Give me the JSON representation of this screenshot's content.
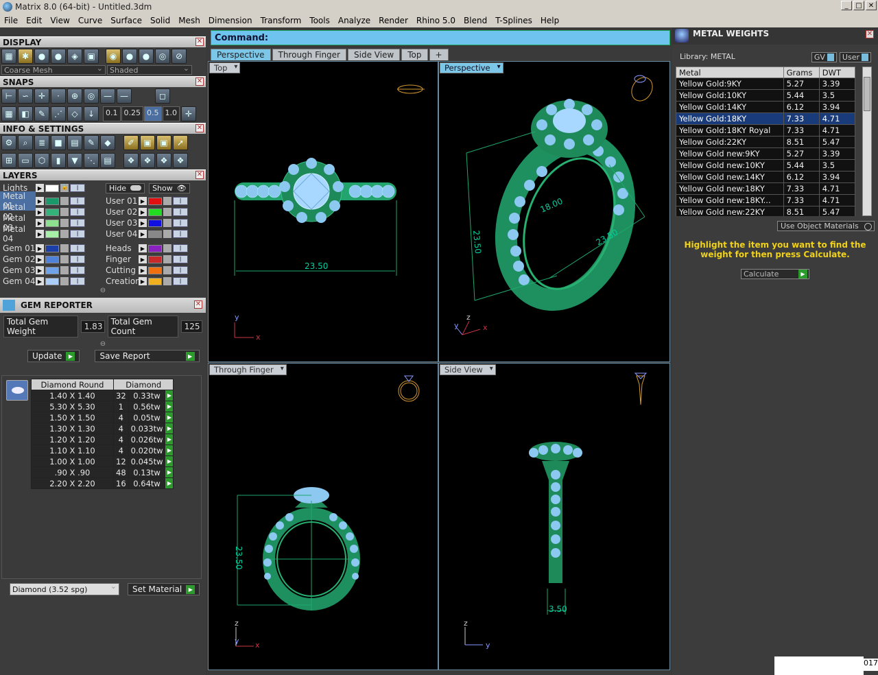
{
  "window": {
    "title": "Matrix 8.0 (64-bit) - Untitled.3dm"
  },
  "menu": [
    "File",
    "Edit",
    "View",
    "Curve",
    "Surface",
    "Solid",
    "Mesh",
    "Dimension",
    "Transform",
    "Tools",
    "Analyze",
    "Render",
    "Rhino 5.0",
    "Blend",
    "T-Splines",
    "Help"
  ],
  "display": {
    "title": "DISPLAY",
    "mesh_select": "Coarse Mesh",
    "shade_select": "Shaded"
  },
  "snaps": {
    "title": "SNAPS",
    "values": [
      "0.1",
      "0.25",
      "0.5",
      "1.0"
    ]
  },
  "info": {
    "title": "INFO & SETTINGS"
  },
  "layers": {
    "title": "LAYERS",
    "lights": "Lights",
    "hide": "Hide",
    "show": "Show",
    "left": [
      {
        "name": "Metal 01",
        "color": "#1a9a6a"
      },
      {
        "name": "Metal 02",
        "color": "#34b27a"
      },
      {
        "name": "Metal 03",
        "color": "#8de08e"
      },
      {
        "name": "Metal 04",
        "color": "#a8f0a8"
      },
      {
        "name": "Gem 01",
        "color": "#1d3fa8"
      },
      {
        "name": "Gem 02",
        "color": "#4f82d8"
      },
      {
        "name": "Gem 03",
        "color": "#6fa2e8"
      },
      {
        "name": "Gem 04",
        "color": "#a9cdf8"
      }
    ],
    "right": [
      {
        "name": "User 01",
        "color": "#e01010"
      },
      {
        "name": "User 02",
        "color": "#22dd22"
      },
      {
        "name": "User 03",
        "color": "#1010e0"
      },
      {
        "name": "User 04",
        "color": "#888888"
      },
      {
        "name": "Heads",
        "color": "#8a22c0"
      },
      {
        "name": "Finger",
        "color": "#c82a2a"
      },
      {
        "name": "Cutting",
        "color": "#f07010"
      },
      {
        "name": "Creation",
        "color": "#f0b020"
      }
    ]
  },
  "gem_reporter": {
    "title": "GEM REPORTER",
    "weight_label": "Total Gem Weight",
    "weight": "1.83",
    "count_label": "Total Gem Count",
    "count": "125",
    "update": "Update",
    "save": "Save Report",
    "col1": "Diamond Round",
    "col2": "Diamond",
    "rows": [
      [
        "1.40 X 1.40",
        "32",
        "0.33tw"
      ],
      [
        "5.30 X 5.30",
        "1",
        "0.56tw"
      ],
      [
        "1.50 X 1.50",
        "4",
        "0.05tw"
      ],
      [
        "1.30 X 1.30",
        "4",
        "0.033tw"
      ],
      [
        "1.20 X 1.20",
        "4",
        "0.026tw"
      ],
      [
        "1.10 X 1.10",
        "4",
        "0.020tw"
      ],
      [
        "1.00 X 1.00",
        "12",
        "0.045tw"
      ],
      [
        ".90 X .90",
        "48",
        "0.13tw"
      ],
      [
        "2.20 X 2.20",
        "16",
        "0.64tw"
      ]
    ],
    "material": "Diamond    (3.52 spg)",
    "set_material": "Set Material"
  },
  "command": {
    "label": "Command:"
  },
  "viewtabs": [
    "Perspective",
    "Through Finger",
    "Side View",
    "Top",
    "+"
  ],
  "viewports": {
    "top": "Top",
    "persp": "Perspective",
    "finger": "Through Finger",
    "side": "Side View",
    "dim_top": "23.50",
    "dim_p1": "23.50",
    "dim_p2": "23.50",
    "dim_p3": "18.00",
    "dim_f": "23.50",
    "dim_s": "3.50"
  },
  "metal_weights": {
    "title": "METAL WEIGHTS",
    "library": "Library: METAL",
    "gv": "GV",
    "user": "User",
    "headers": [
      "Metal",
      "Grams",
      "DWT"
    ],
    "rows": [
      [
        "Yellow Gold:9KY",
        "5.27",
        "3.39"
      ],
      [
        "Yellow Gold:10KY",
        "5.44",
        "3.5"
      ],
      [
        "Yellow Gold:14KY",
        "6.12",
        "3.94"
      ],
      [
        "Yellow Gold:18KY",
        "7.33",
        "4.71"
      ],
      [
        "Yellow Gold:18KY Royal",
        "7.33",
        "4.71"
      ],
      [
        "Yellow Gold:22KY",
        "8.51",
        "5.47"
      ],
      [
        "Yellow Gold new:9KY",
        "5.27",
        "3.39"
      ],
      [
        "Yellow Gold new:10KY",
        "5.44",
        "3.5"
      ],
      [
        "Yellow Gold new:14KY",
        "6.12",
        "3.94"
      ],
      [
        "Yellow Gold new:18KY",
        "7.33",
        "4.71"
      ],
      [
        "Yellow Gold new:18KY...",
        "7.33",
        "4.71"
      ],
      [
        "Yellow Gold new:22KY",
        "8.51",
        "5.47"
      ]
    ],
    "selected_row": 3,
    "use_object": "Use Object Materials",
    "hint": "Highlight the item you want to find the weight for then press Calculate.",
    "calculate": "Calculate"
  },
  "status": {
    "corner": "017"
  }
}
